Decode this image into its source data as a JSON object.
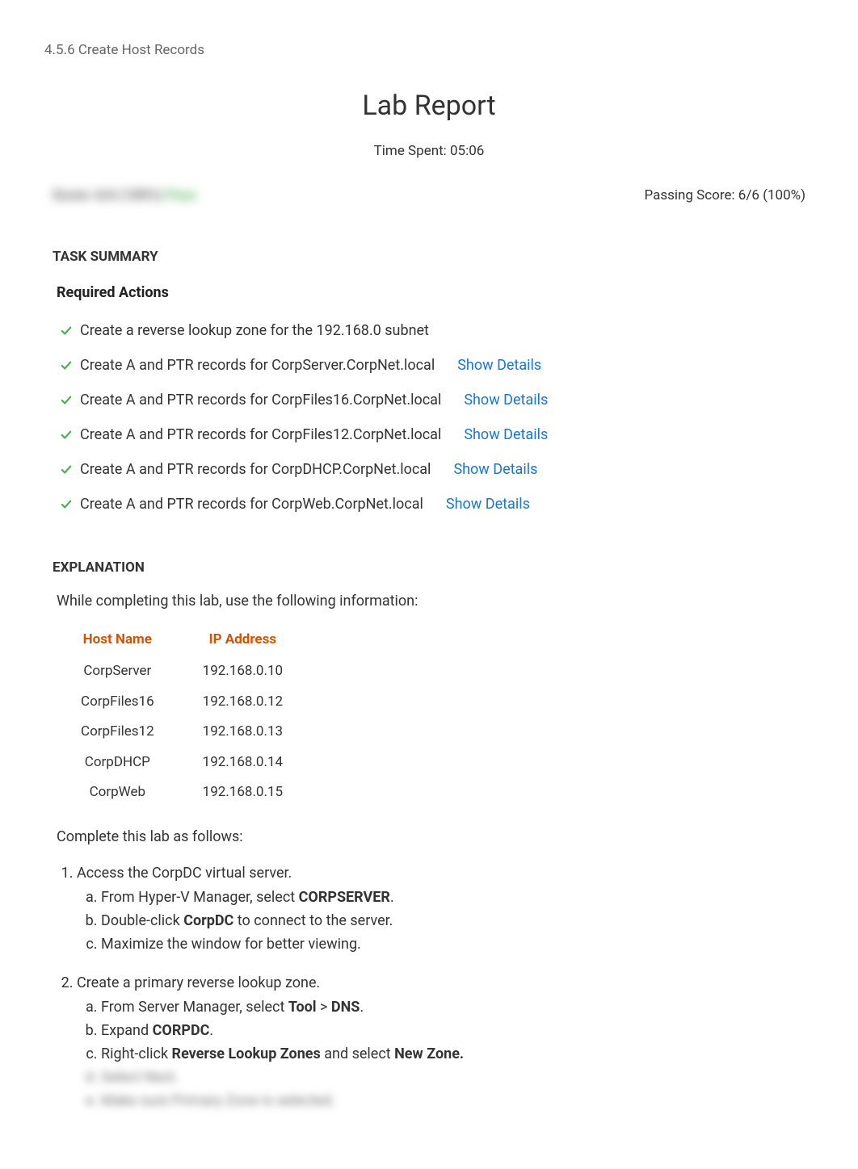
{
  "breadcrumb": "4.5.6 Create Host Records",
  "title": "Lab Report",
  "timeSpentLabel": "Time Spent: 05:06",
  "scoreLeft": {
    "prefix": "Score: 6/6 (100%)",
    "status": "Pass"
  },
  "passingScore": "Passing Score: 6/6 (100%)",
  "taskSummaryHeader": "TASK SUMMARY",
  "requiredActionsHeader": "Required Actions",
  "showDetailsLabel": "Show Details",
  "actions": [
    {
      "text": "Create a reverse lookup zone for the 192.168.0 subnet",
      "hasDetails": false
    },
    {
      "text": "Create A and PTR records for CorpServer.CorpNet.local",
      "hasDetails": true
    },
    {
      "text": "Create A and PTR records for CorpFiles16.CorpNet.local",
      "hasDetails": true
    },
    {
      "text": "Create A and PTR records for CorpFiles12.CorpNet.local",
      "hasDetails": true
    },
    {
      "text": "Create A and PTR records for CorpDHCP.CorpNet.local",
      "hasDetails": true
    },
    {
      "text": "Create A and PTR records for CorpWeb.CorpNet.local",
      "hasDetails": true
    }
  ],
  "explanationHeader": "EXPLANATION",
  "explanationIntro": "While completing this lab, use the following information:",
  "tableHeaders": {
    "col1": "Host Name",
    "col2": "IP Address"
  },
  "tableRows": [
    {
      "host": "CorpServer",
      "ip": "192.168.0.10"
    },
    {
      "host": "CorpFiles16",
      "ip": "192.168.0.12"
    },
    {
      "host": "CorpFiles12",
      "ip": "192.168.0.13"
    },
    {
      "host": "CorpDHCP",
      "ip": "192.168.0.14"
    },
    {
      "host": "CorpWeb",
      "ip": "192.168.0.15"
    }
  ],
  "completeText": "Complete this lab as follows:",
  "step1": {
    "title": "Access the CorpDC virtual server.",
    "a1": "From Hyper-V Manager, select ",
    "a1b": "CORPSERVER",
    "a1end": ".",
    "b1": "Double-click ",
    "b1b": "CorpDC",
    "b1end": " to connect to the server.",
    "c1": "Maximize the window for better viewing."
  },
  "step2": {
    "title": "Create a primary reverse lookup zone.",
    "a1": "From Server Manager, select ",
    "a1b": "Tool",
    "a1mid": " > ",
    "a1b2": "DNS",
    "a1end": ".",
    "b1": "Expand ",
    "b1b": "CORPDC",
    "b1end": ".",
    "c1": "Right-click ",
    "c1b": "Reverse Lookup Zones",
    "c1mid": " and select ",
    "c1b2": "New Zone.",
    "d1": "Select Next.",
    "e1": "Make sure Primary Zone is selected."
  }
}
